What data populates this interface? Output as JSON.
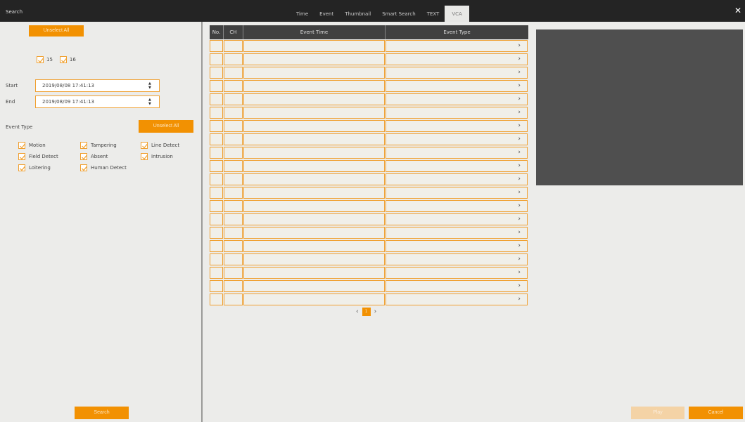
{
  "window": {
    "title": "Search",
    "close_icon": "close-icon"
  },
  "tabs": [
    {
      "label": "Time"
    },
    {
      "label": "Event"
    },
    {
      "label": "Thumbnail"
    },
    {
      "label": "Smart Search"
    },
    {
      "label": "TEXT"
    },
    {
      "label": "VCA",
      "active": true
    }
  ],
  "left": {
    "unselect_all_label": "Unselect All",
    "channels": [
      {
        "label": "15",
        "checked": true
      },
      {
        "label": "16",
        "checked": true
      }
    ],
    "start_label": "Start",
    "start_value": "2019/08/08 17:41:13",
    "end_label": "End",
    "end_value": "2019/08/09 17:41:13",
    "event_type_label": "Event Type",
    "event_unselect_all_label": "Unselect All",
    "event_types": [
      {
        "label": "Motion",
        "checked": true
      },
      {
        "label": "Tampering",
        "checked": true
      },
      {
        "label": "Line Detect",
        "checked": true
      },
      {
        "label": "Field Detect",
        "checked": true
      },
      {
        "label": "Absent",
        "checked": true
      },
      {
        "label": "Intrusion",
        "checked": true
      },
      {
        "label": "Loitering",
        "checked": true
      },
      {
        "label": "Human Detect",
        "checked": true
      }
    ],
    "search_label": "Search"
  },
  "table": {
    "columns": [
      "No.",
      "CH",
      "Event Time",
      "Event Type"
    ],
    "row_count": 20
  },
  "pager": {
    "current": "1"
  },
  "footer": {
    "play_label": "Play",
    "cancel_label": "Cancel"
  },
  "colors": {
    "accent": "#f29102",
    "titlebar": "#242424",
    "preview": "#4f4f4f"
  }
}
